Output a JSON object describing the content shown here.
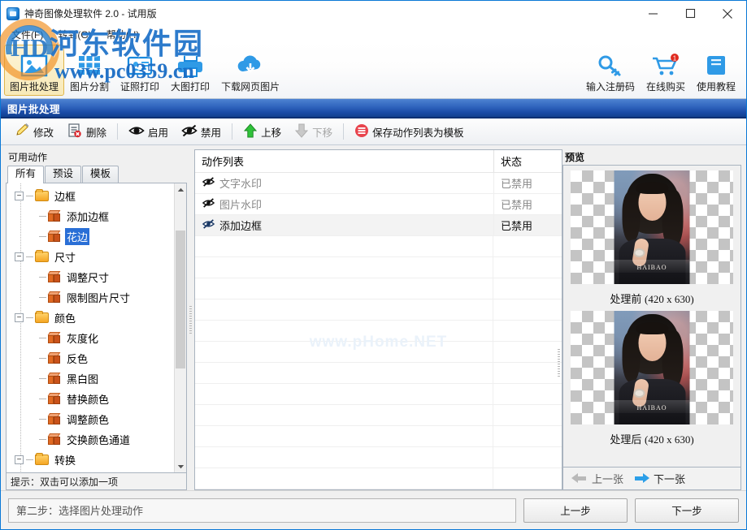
{
  "window": {
    "title": "神奇图像处理软件 2.0 - 试用版",
    "icon": "app-icon",
    "minimize": "–",
    "maximize": "□",
    "close": "✕"
  },
  "menubar": {
    "items": [
      {
        "label": "文件(F)"
      },
      {
        "label": "转到(G)"
      },
      {
        "label": "帮助(H)"
      }
    ]
  },
  "ribbon": {
    "left_items": [
      {
        "label": "图片批处理",
        "icon": "picture-batch-icon",
        "active": true
      },
      {
        "label": "图片分割",
        "icon": "grid-split-icon",
        "active": false
      },
      {
        "label": "证照打印",
        "icon": "id-card-icon",
        "active": false
      },
      {
        "label": "大图打印",
        "icon": "printer-icon",
        "active": false
      },
      {
        "label": "下载网页图片",
        "icon": "cloud-download-icon",
        "active": false
      }
    ],
    "right_items": [
      {
        "label": "输入注册码",
        "icon": "key-icon",
        "badge": ""
      },
      {
        "label": "在线购买",
        "icon": "shopping-cart-icon",
        "badge": "1"
      },
      {
        "label": "使用教程",
        "icon": "book-icon",
        "badge": ""
      }
    ]
  },
  "section": {
    "title": "图片批处理"
  },
  "action_toolbar": {
    "buttons": [
      {
        "label": "修改",
        "icon": "pencil-icon",
        "enabled": true
      },
      {
        "label": "删除",
        "icon": "delete-icon",
        "enabled": true
      },
      {
        "label": "启用",
        "icon": "eye-icon",
        "enabled": true
      },
      {
        "label": "禁用",
        "icon": "eye-off-icon",
        "enabled": true
      },
      {
        "label": "上移",
        "icon": "arrow-up-icon",
        "enabled": true
      },
      {
        "label": "下移",
        "icon": "arrow-down-icon",
        "enabled": false
      },
      {
        "label": "保存动作列表为模板",
        "icon": "save-template-icon",
        "enabled": true
      }
    ]
  },
  "left_panel": {
    "title": "可用动作",
    "tabs": [
      {
        "label": "所有",
        "active": true
      },
      {
        "label": "预设",
        "active": false
      },
      {
        "label": "模板",
        "active": false
      }
    ],
    "tree": [
      {
        "label": "边框",
        "type": "folder",
        "expanded": true
      },
      {
        "label": "添加边框",
        "type": "item",
        "selected": false
      },
      {
        "label": "花边",
        "type": "item",
        "selected": true
      },
      {
        "label": "尺寸",
        "type": "folder",
        "expanded": true
      },
      {
        "label": "调整尺寸",
        "type": "item",
        "selected": false
      },
      {
        "label": "限制图片尺寸",
        "type": "item",
        "selected": false
      },
      {
        "label": "颜色",
        "type": "folder",
        "expanded": true
      },
      {
        "label": "灰度化",
        "type": "item",
        "selected": false
      },
      {
        "label": "反色",
        "type": "item",
        "selected": false
      },
      {
        "label": "黑白图",
        "type": "item",
        "selected": false
      },
      {
        "label": "替换颜色",
        "type": "item",
        "selected": false
      },
      {
        "label": "调整颜色",
        "type": "item",
        "selected": false
      },
      {
        "label": "交换颜色通道",
        "type": "item",
        "selected": false
      },
      {
        "label": "转换",
        "type": "folder",
        "expanded": true
      }
    ],
    "hint": "提示：双击可以添加一项"
  },
  "action_list": {
    "columns": {
      "name": "动作列表",
      "status": "状态"
    },
    "rows": [
      {
        "name": "文字水印",
        "status": "已禁用",
        "icon": "disabled-icon",
        "selected": false
      },
      {
        "name": "图片水印",
        "status": "已禁用",
        "icon": "disabled-icon",
        "selected": false
      },
      {
        "name": "添加边框",
        "status": "已禁用",
        "icon": "disabled-icon",
        "selected": true
      }
    ],
    "watermark": "www.pHome.NET"
  },
  "preview": {
    "title": "预览",
    "before": {
      "caption_label": "处理前",
      "caption_size": "(420 x 630)",
      "image_brand": "HAIBAO"
    },
    "after": {
      "caption_label": "处理后",
      "caption_size": "(420 x 630)",
      "image_brand": "HAIBAO"
    },
    "nav": {
      "prev": {
        "label": "上一张",
        "enabled": false
      },
      "next": {
        "label": "下一张",
        "enabled": true
      }
    }
  },
  "footer": {
    "step_text": "第二步：选择图片处理动作",
    "prev_button": "上一步",
    "next_button": "下一步"
  },
  "watermark_overlay": {
    "logo_text": "HD",
    "site_name": "河东软件园",
    "url": "www.pc0359.cn"
  },
  "colors": {
    "accent_blue": "#1a66c8",
    "header_blue": "#2f63bc",
    "selection_blue": "#2a6fd6",
    "badge_red": "#e02b20",
    "folder_orange": "#f5a623",
    "box_orange": "#e06a23",
    "disabled_gray": "#a6a6a6"
  }
}
